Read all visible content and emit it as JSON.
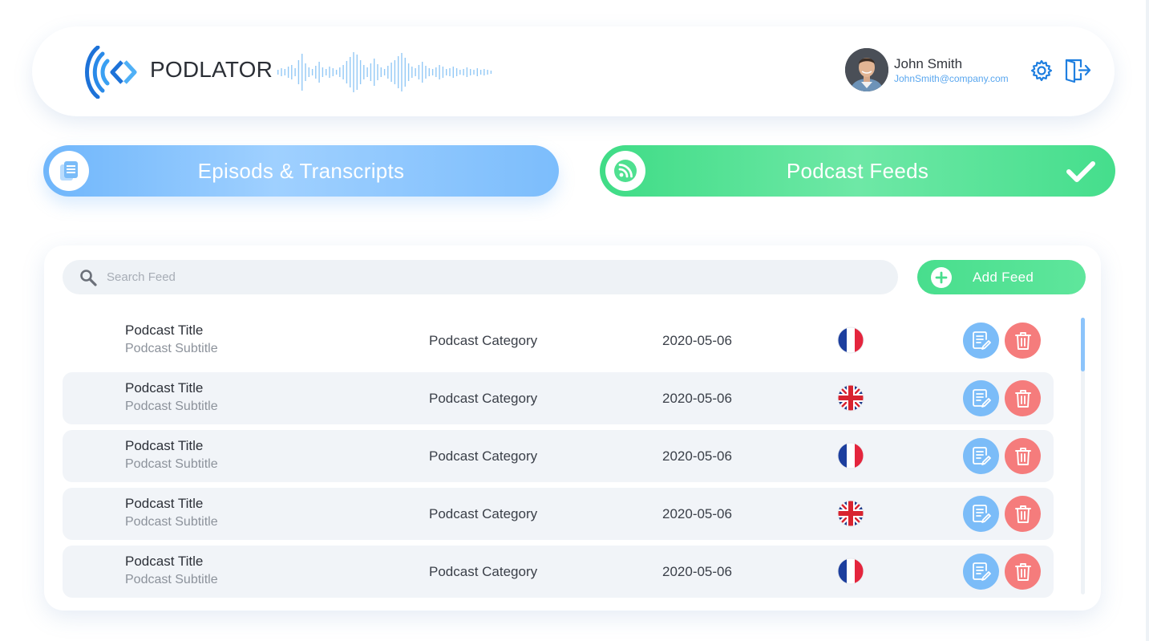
{
  "colors": {
    "accent_blue": "#7bbcf8",
    "accent_green": "#48de8d",
    "delete_red": "#f57c7c",
    "row_shade": "#f1f4f8"
  },
  "header": {
    "brand": "PODLATOR",
    "logo_icon": "podlator-logo-icon",
    "wave_icon": "audio-waveform-icon",
    "user": {
      "name": "John Smith",
      "email": "JohnSmith@company.com"
    },
    "settings_icon": "gear-icon",
    "logout_icon": "logout-icon"
  },
  "tabs": [
    {
      "label": "Episods & Transcripts",
      "icon": "documents-icon",
      "active": false
    },
    {
      "label": "Podcast Feeds",
      "icon": "rss-icon",
      "active": true,
      "check_icon": "checkmark-icon"
    }
  ],
  "search": {
    "placeholder": "Search Feed",
    "value": ""
  },
  "add_feed": {
    "label": "Add Feed",
    "icon": "plus-circle-icon"
  },
  "feeds": [
    {
      "title": "Podcast Title",
      "subtitle": "Podcast Subtitle",
      "category": "Podcast Category",
      "date": "2020-05-06",
      "language": "fr",
      "flag_icon": "france-flag-icon"
    },
    {
      "title": "Podcast Title",
      "subtitle": "Podcast Subtitle",
      "category": "Podcast Category",
      "date": "2020-05-06",
      "language": "en",
      "flag_icon": "uk-flag-icon"
    },
    {
      "title": "Podcast Title",
      "subtitle": "Podcast Subtitle",
      "category": "Podcast Category",
      "date": "2020-05-06",
      "language": "fr",
      "flag_icon": "france-flag-icon"
    },
    {
      "title": "Podcast Title",
      "subtitle": "Podcast Subtitle",
      "category": "Podcast Category",
      "date": "2020-05-06",
      "language": "en",
      "flag_icon": "uk-flag-icon"
    },
    {
      "title": "Podcast Title",
      "subtitle": "Podcast Subtitle",
      "category": "Podcast Category",
      "date": "2020-05-06",
      "language": "fr",
      "flag_icon": "france-flag-icon"
    }
  ],
  "row_actions": {
    "edit_icon": "edit-document-icon",
    "delete_icon": "trash-icon"
  }
}
